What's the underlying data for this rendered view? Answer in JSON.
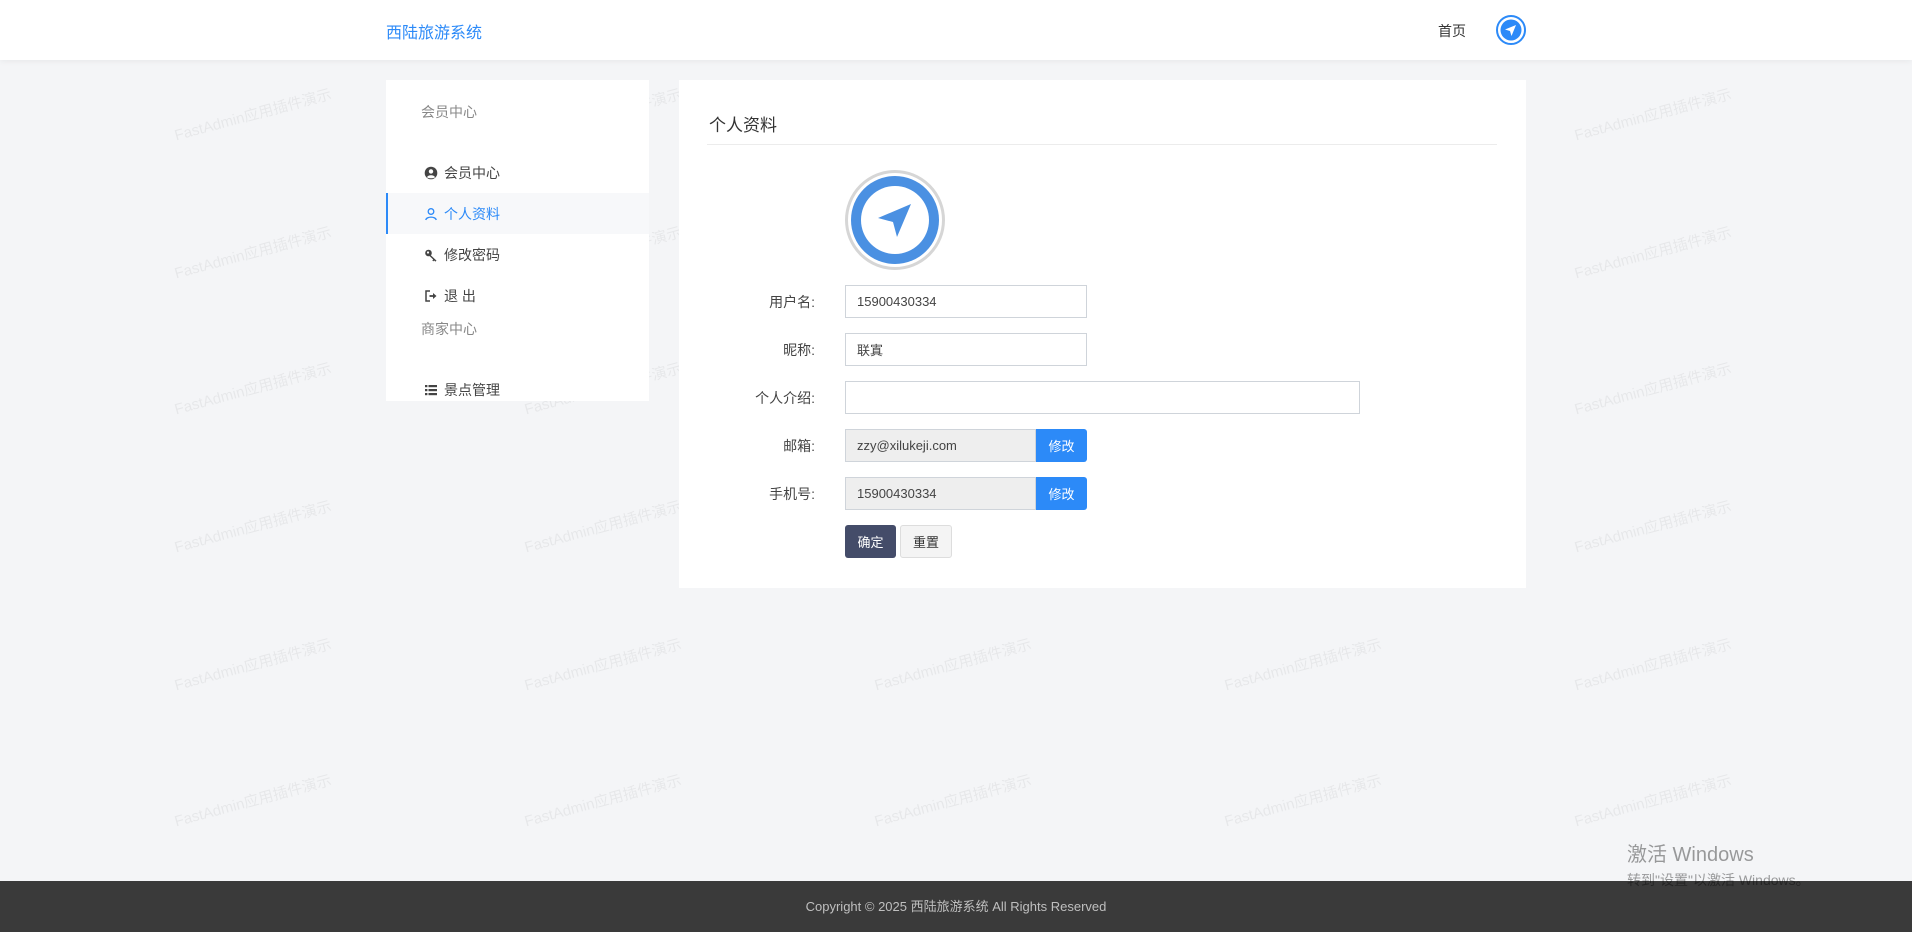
{
  "header": {
    "brand": "西陆旅游系统",
    "home_link": "首页"
  },
  "watermark_text": "FastAdmin应用插件演示",
  "sidebar": {
    "member_heading": "会员中心",
    "member_items": [
      {
        "label": "会员中心",
        "icon": "user-circle-icon"
      },
      {
        "label": "个人资料",
        "icon": "user-icon",
        "active": true
      },
      {
        "label": "修改密码",
        "icon": "key-icon"
      },
      {
        "label": "退 出",
        "icon": "sign-out-icon"
      }
    ],
    "merchant_heading": "商家中心",
    "merchant_items": [
      {
        "label": "景点管理",
        "icon": "list-icon"
      }
    ]
  },
  "profile": {
    "title": "个人资料",
    "username_label": "用户名:",
    "username_value": "15900430334",
    "nickname_label": "昵称:",
    "nickname_value": "联寘",
    "bio_label": "个人介绍:",
    "bio_value": "",
    "email_label": "邮箱:",
    "email_value": "zzy@xilukeji.com",
    "email_modify": "修改",
    "mobile_label": "手机号:",
    "mobile_value": "15900430334",
    "mobile_modify": "修改",
    "submit_label": "确定",
    "reset_label": "重置"
  },
  "windows_activation": {
    "title": "激活 Windows",
    "subtitle": "转到\"设置\"以激活 Windows。"
  },
  "footer": {
    "copyright": "Copyright © 2025 西陆旅游系统 All Rights Reserved"
  },
  "colors": {
    "accent": "#2c8af8",
    "submit": "#444c69",
    "footer": "#3a3a3a",
    "background": "#f4f5f7"
  }
}
